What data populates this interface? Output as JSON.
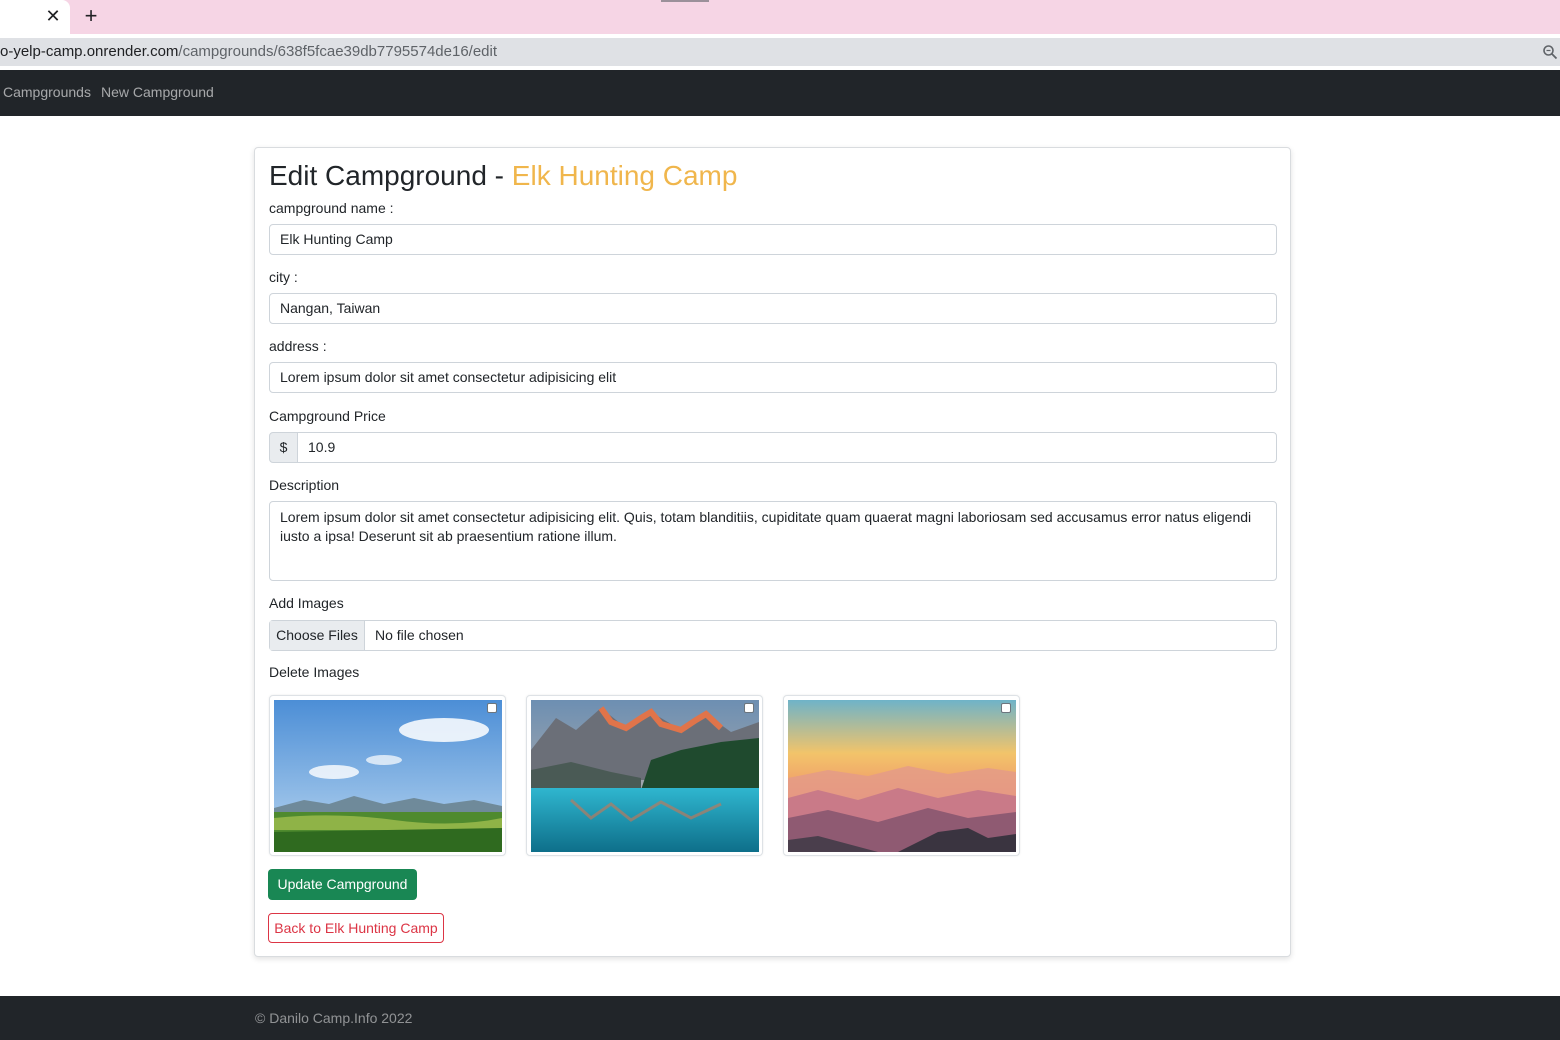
{
  "browser": {
    "tab_close": "✕",
    "new_tab": "+",
    "url_host": "o-yelp-camp.onrender.com",
    "url_path": "/campgrounds/638f5fcae39db7795574de16/edit",
    "zoom_icon": "magnifier-icon"
  },
  "nav": {
    "items": [
      "Campgrounds",
      "New Campground"
    ]
  },
  "form": {
    "title_prefix": "Edit Campground - ",
    "title_name": "Elk Hunting Camp",
    "name_label": "campground name :",
    "name_value": "Elk Hunting Camp",
    "city_label": "city :",
    "city_value": "Nangan, Taiwan",
    "address_label": "address :",
    "address_value": "Lorem ipsum dolor sit amet consectetur adipisicing elit",
    "price_label": "Campground Price",
    "price_addon": "$",
    "price_value": "10.9",
    "description_label": "Description",
    "description_value": "Lorem ipsum dolor sit amet consectetur adipisicing elit. Quis, totam blanditiis, cupiditate quam quaerat magni laboriosam sed accusamus error natus eligendi iusto a ipsa! Deserunt sit ab praesentium ratione illum.",
    "add_images_label": "Add Images",
    "choose_files": "Choose Files",
    "no_file": "No file chosen",
    "delete_images_label": "Delete Images",
    "images": [
      {
        "scene": "green-meadow-hills"
      },
      {
        "scene": "mountain-lake"
      },
      {
        "scene": "sunset-mountain-ridges"
      }
    ],
    "update_button": "Update Campground",
    "back_button": "Back to Elk Hunting Camp"
  },
  "footer": {
    "text": "© Danilo Camp.Info 2022"
  },
  "colors": {
    "accent": "#f0b64c",
    "navbar": "#212529",
    "success": "#198754",
    "danger": "#dc3545",
    "tabstrip": "#f6d5e5"
  }
}
